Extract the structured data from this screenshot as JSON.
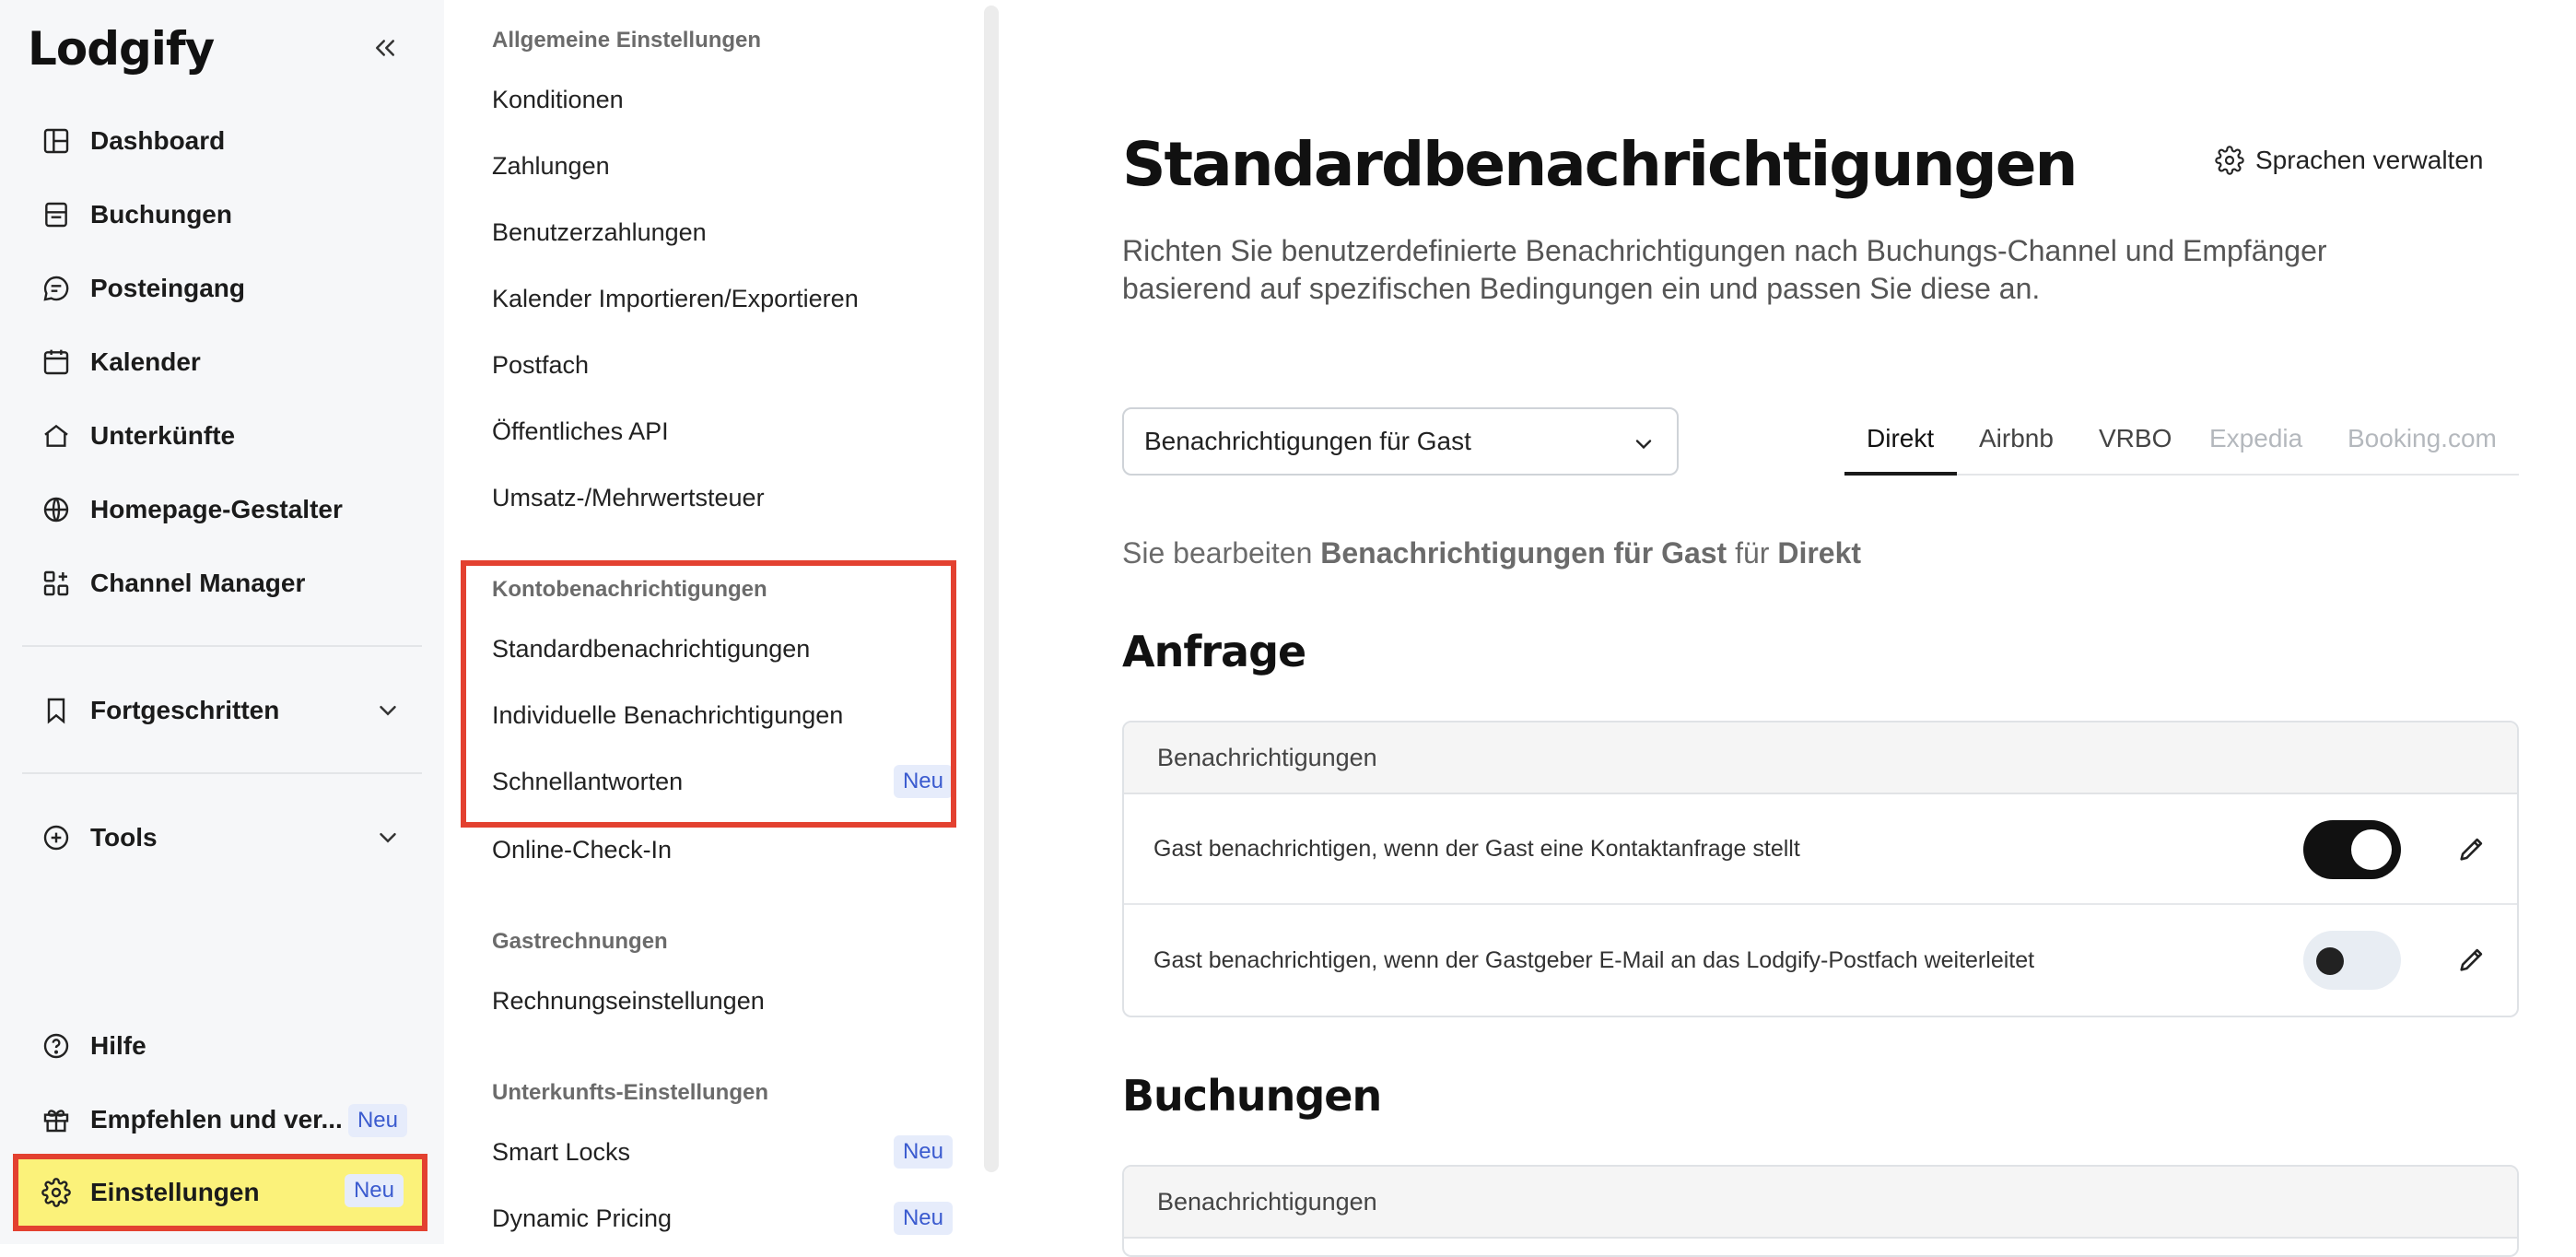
{
  "app": {
    "logo": "Lodgify"
  },
  "sidebar": {
    "items": [
      {
        "label": "Dashboard",
        "icon": "layout-icon"
      },
      {
        "label": "Buchungen",
        "icon": "booking-icon"
      },
      {
        "label": "Posteingang",
        "icon": "chat-icon"
      },
      {
        "label": "Kalender",
        "icon": "calendar-icon"
      },
      {
        "label": "Unterkünfte",
        "icon": "home-icon"
      },
      {
        "label": "Homepage-Gestalter",
        "icon": "globe-icon"
      },
      {
        "label": "Channel Manager",
        "icon": "grid-plus-icon"
      }
    ],
    "advanced": {
      "label": "Fortgeschritten"
    },
    "tools": {
      "label": "Tools"
    },
    "bottom": {
      "help": "Hilfe",
      "refer": "Empfehlen und ver...",
      "refer_badge": "Neu",
      "settings": "Einstellungen",
      "settings_badge": "Neu"
    }
  },
  "settings_menu": {
    "general_title": "Allgemeine Einstellungen",
    "general": [
      "Konditionen",
      "Zahlungen",
      "Benutzerzahlungen",
      "Kalender Importieren/Exportieren",
      "Postfach",
      "Öffentliches API",
      "Umsatz-/Mehrwertsteuer"
    ],
    "notifications_title": "Kontobenachrichtigungen",
    "notifications": [
      "Standardbenachrichtigungen",
      "Individuelle Benachrichtigungen",
      "Schnellantworten"
    ],
    "quick_badge": "Neu",
    "checkin": "Online-Check-In",
    "invoices_title": "Gastrechnungen",
    "invoices": [
      "Rechnungseinstellungen"
    ],
    "property_title": "Unterkunfts-Einstellungen",
    "property": [
      "Smart Locks",
      "Dynamic Pricing"
    ],
    "property_badge": "Neu"
  },
  "main": {
    "title": "Standardbenachrichtigungen",
    "manage_languages": "Sprachen verwalten",
    "subtitle": "Richten Sie benutzerdefinierte Benachrichtigungen nach Buchungs-Channel und Empfänger basierend auf spezifischen Bedingungen ein und passen Sie diese an.",
    "recipient_select": "Benachrichtigungen für Gast",
    "tabs": [
      {
        "label": "Direkt",
        "state": "active"
      },
      {
        "label": "Airbnb",
        "state": "enabled"
      },
      {
        "label": "VRBO",
        "state": "enabled"
      },
      {
        "label": "Expedia",
        "state": "disabled"
      },
      {
        "label": "Booking.com",
        "state": "disabled"
      }
    ],
    "editing_prefix": "Sie bearbeiten",
    "editing_target": "Benachrichtigungen für Gast",
    "editing_for": "für",
    "editing_channel": "Direkt",
    "sections": [
      {
        "title": "Anfrage",
        "header": "Benachrichtigungen",
        "rows": [
          {
            "text": "Gast benachrichtigen, wenn der Gast eine Kontaktanfrage stellt",
            "enabled": true
          },
          {
            "text": "Gast benachrichtigen, wenn der Gastgeber E-Mail an das Lodgify-Postfach weiterleitet",
            "enabled": false
          }
        ]
      },
      {
        "title": "Buchungen",
        "header": "Benachrichtigungen",
        "rows": []
      }
    ]
  }
}
